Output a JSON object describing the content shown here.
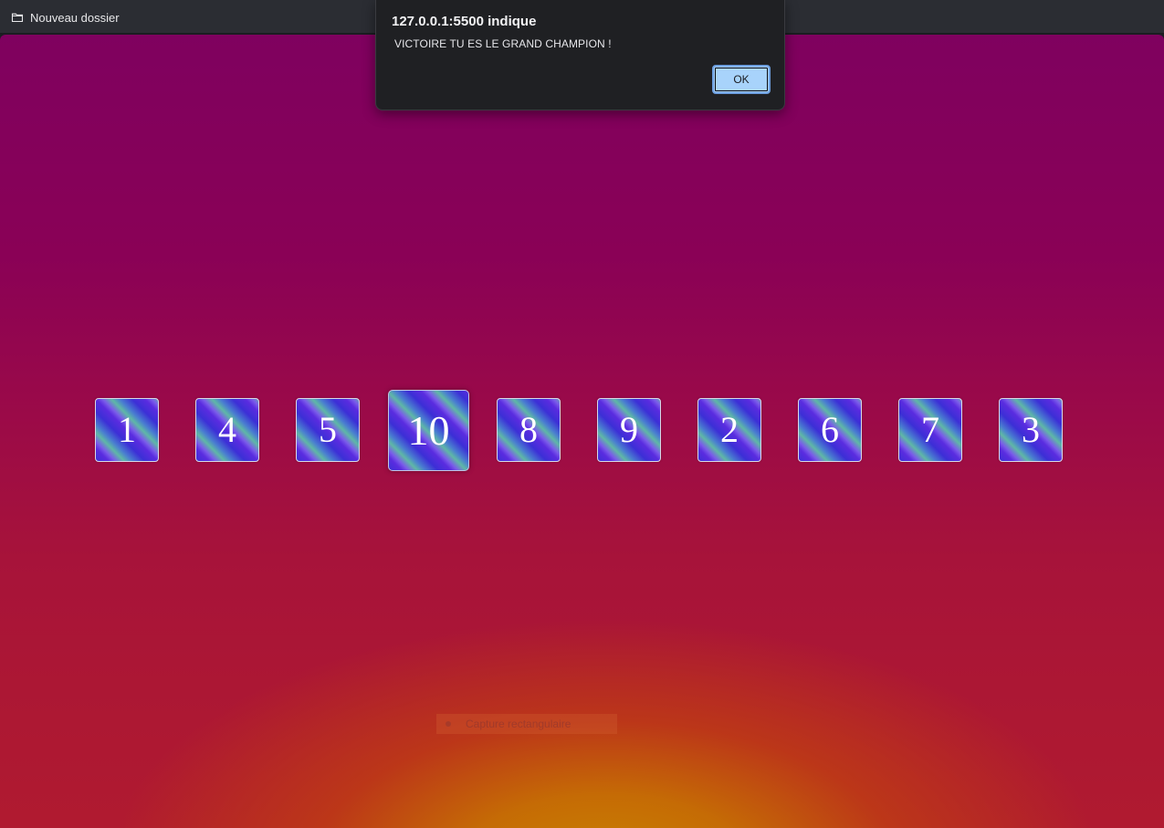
{
  "bookmarks_bar": {
    "items": [
      {
        "label": "Nouveau dossier",
        "icon": "folder-icon"
      }
    ]
  },
  "game": {
    "tiles": [
      "1",
      "4",
      "5",
      "10",
      "8",
      "9",
      "2",
      "6",
      "7",
      "3"
    ],
    "highlighted_tile": "10"
  },
  "alert": {
    "title": "127.0.0.1:5500 indique",
    "message": "VICTOIRE TU ES LE GRAND CHAMPION  !",
    "ok_label": "OK"
  },
  "snip_overlay": {
    "label": "Capture rectangulaire"
  },
  "colors": {
    "background_top": "#7f015f",
    "background_bottom": "#b01a30",
    "glow": "#c98300",
    "ok_button": "#a8d3fb",
    "dialog_bg": "#1f2023"
  }
}
